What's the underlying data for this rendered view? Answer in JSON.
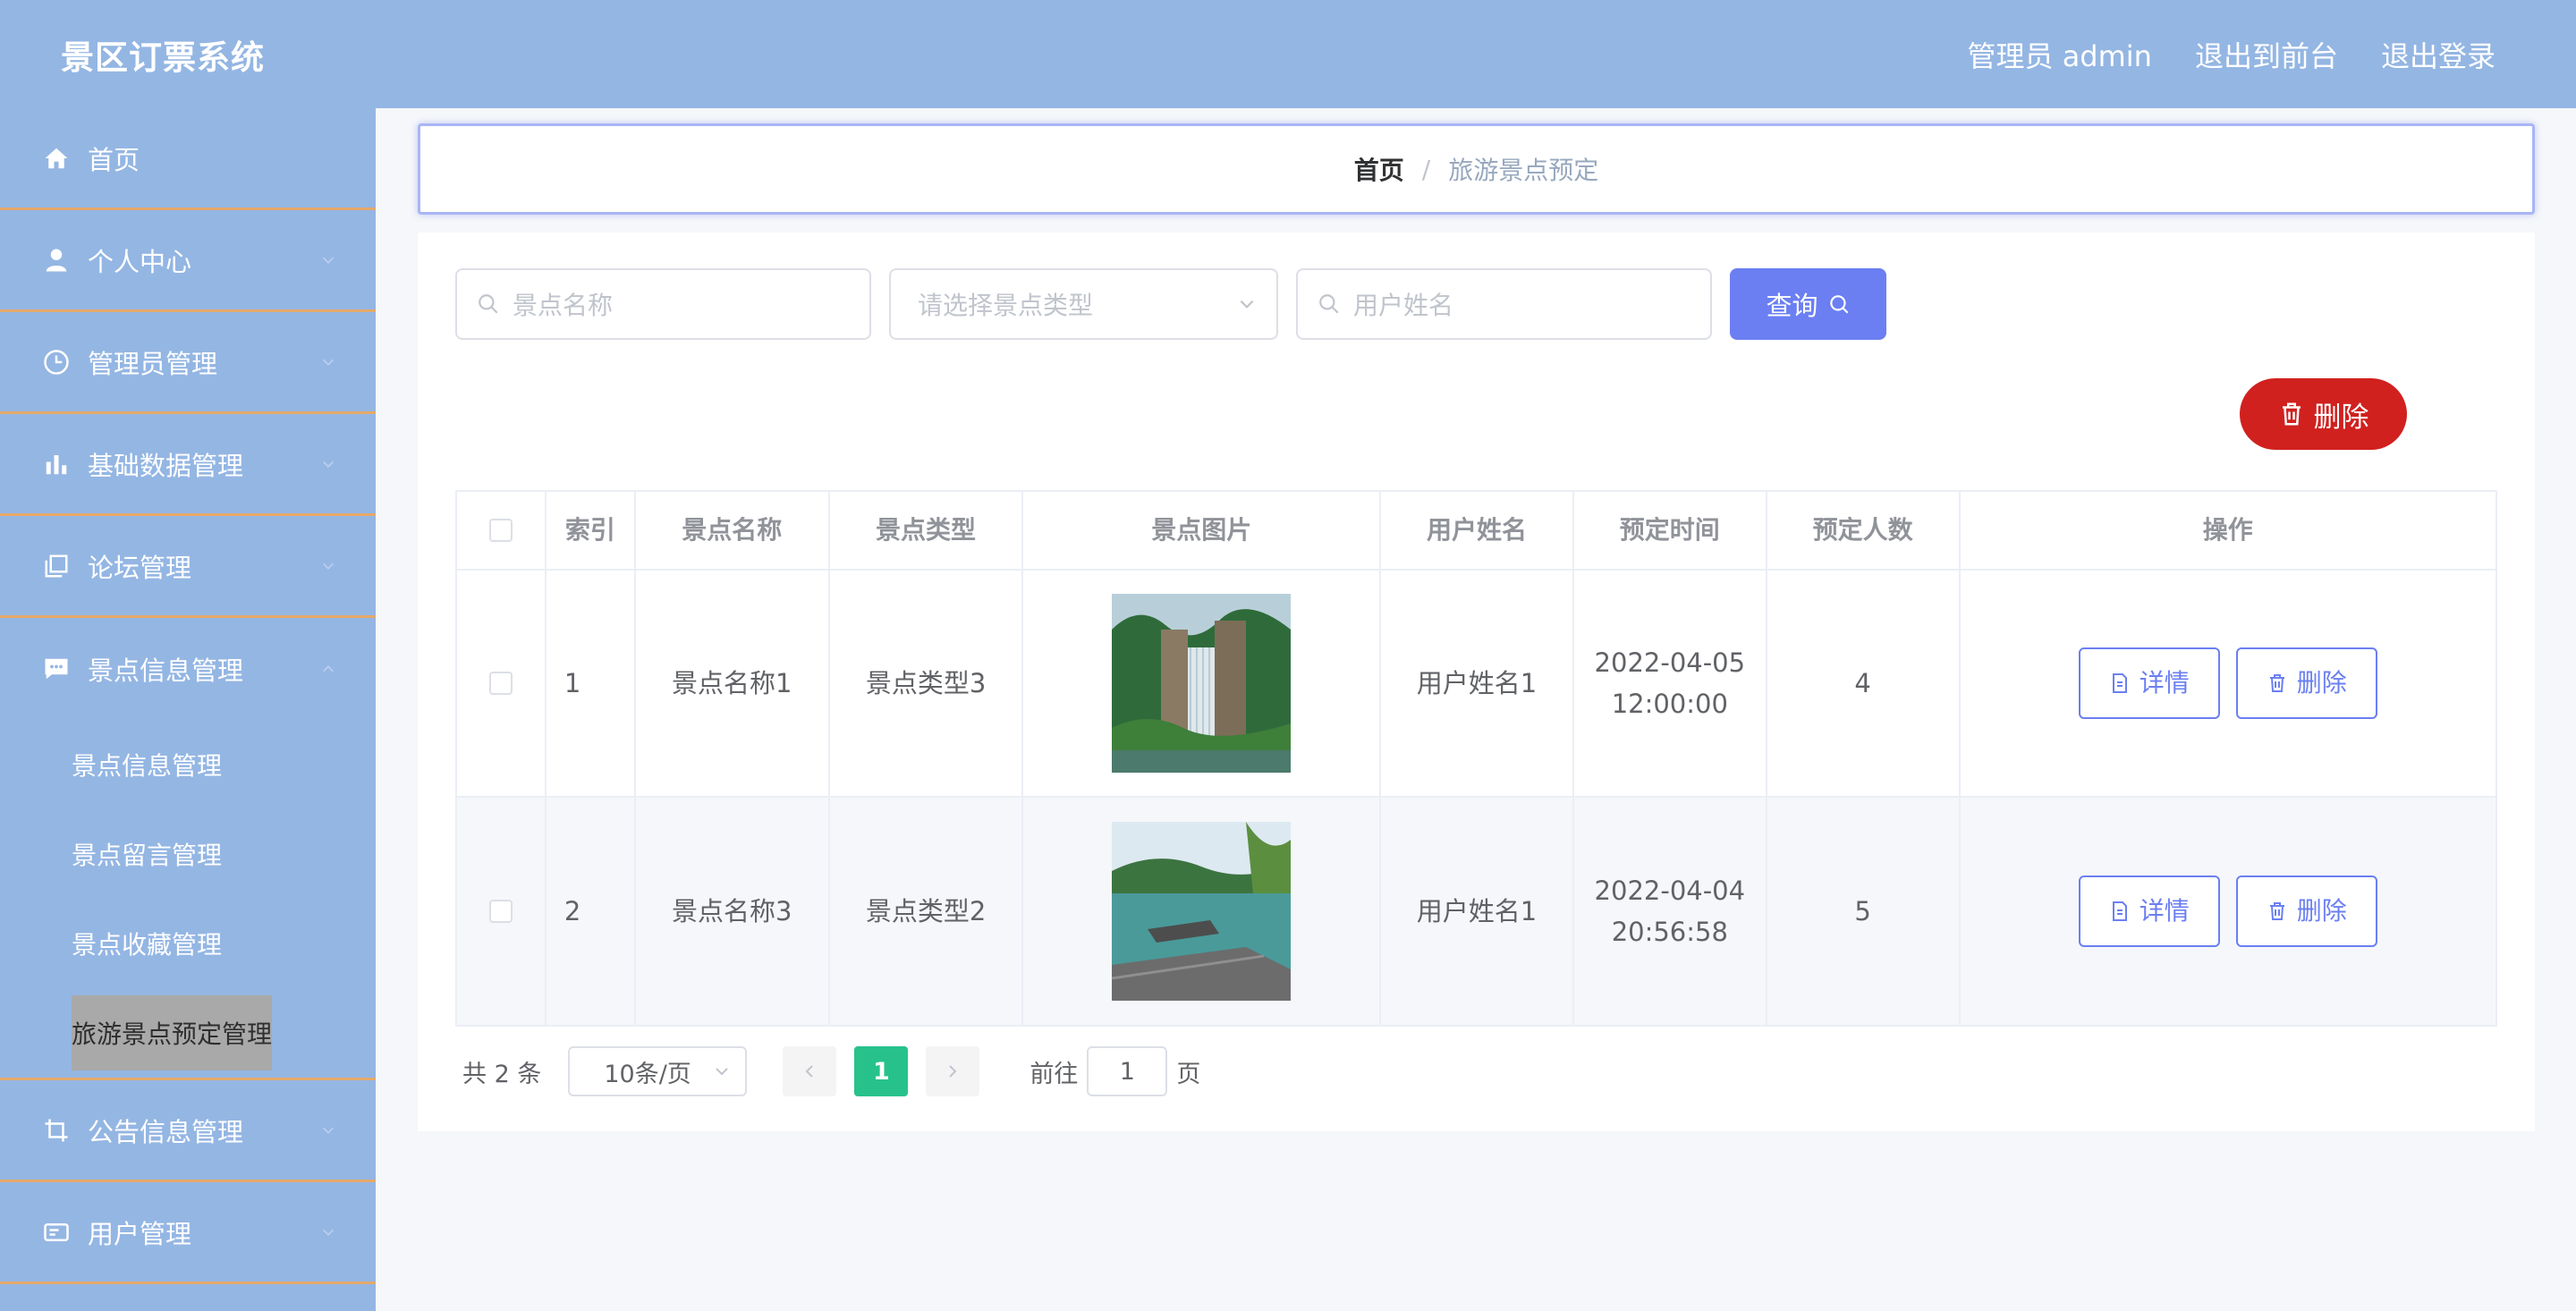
{
  "header": {
    "title": "景区订票系统",
    "user": "管理员 admin",
    "exit_front": "退出到前台",
    "logout": "退出登录"
  },
  "sidebar": {
    "items": [
      {
        "label": "首页",
        "icon": "home-icon"
      },
      {
        "label": "个人中心",
        "icon": "user-icon"
      },
      {
        "label": "管理员管理",
        "icon": "clock-icon"
      },
      {
        "label": "基础数据管理",
        "icon": "bar-chart-icon"
      },
      {
        "label": "论坛管理",
        "icon": "copy-icon"
      },
      {
        "label": "景点信息管理",
        "icon": "chat-icon"
      },
      {
        "label": "公告信息管理",
        "icon": "crop-icon"
      },
      {
        "label": "用户管理",
        "icon": "id-card-icon"
      }
    ],
    "sub_items": [
      {
        "label": "景点信息管理"
      },
      {
        "label": "景点留言管理"
      },
      {
        "label": "景点收藏管理"
      },
      {
        "label": "旅游景点预定管理",
        "active": true
      }
    ]
  },
  "breadcrumb": {
    "home": "首页",
    "separator": "/",
    "current": "旅游景点预定"
  },
  "search": {
    "name_placeholder": "景点名称",
    "type_placeholder": "请选择景点类型",
    "user_placeholder": "用户姓名",
    "query_label": "查询"
  },
  "toolbar": {
    "delete_label": "删除"
  },
  "table": {
    "headers": [
      "索引",
      "景点名称",
      "景点类型",
      "景点图片",
      "用户姓名",
      "预定时间",
      "预定人数",
      "操作"
    ],
    "rows": [
      {
        "index": "1",
        "name": "景点名称1",
        "type": "景点类型3",
        "user": "用户姓名1",
        "date": "2022-04-05",
        "time": "12:00:00",
        "count": "4",
        "detail": "详情",
        "delete": "删除"
      },
      {
        "index": "2",
        "name": "景点名称3",
        "type": "景点类型2",
        "user": "用户姓名1",
        "date": "2022-04-04",
        "time": "20:56:58",
        "count": "5",
        "detail": "详情",
        "delete": "删除"
      }
    ]
  },
  "pagination": {
    "total": "共 2 条",
    "page_size": "10条/页",
    "current_page": "1",
    "goto_label": "前往",
    "goto_value": "1",
    "page_suffix": "页"
  },
  "colors": {
    "header_bg": "#94b6e3",
    "primary": "#6b7ff2",
    "danger": "#d0211f",
    "pager_active": "#27c28c",
    "menu_divider": "#e5a969"
  }
}
